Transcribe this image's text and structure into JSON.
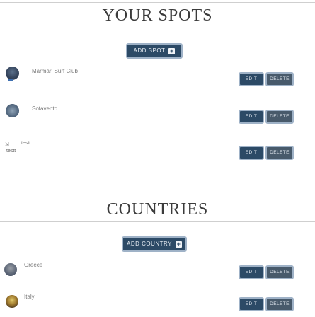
{
  "spots": {
    "title": "YOUR SPOTS",
    "add_button": "ADD SPOT",
    "items": [
      {
        "label": "Marmari Surf Club",
        "edit": "EDIT",
        "delete": "DELETE"
      },
      {
        "label": "Sotavento",
        "edit": "EDIT",
        "delete": "DELETE"
      },
      {
        "label": "testt",
        "sub_label": "testt",
        "edit": "EDIT",
        "delete": "DELETE"
      }
    ]
  },
  "countries": {
    "title": "COUNTRIES",
    "add_button": "ADD COUNTRY",
    "items": [
      {
        "label": "Greece",
        "edit": "EDIT",
        "delete": "DELETE"
      },
      {
        "label": "Italy",
        "edit": "EDIT",
        "delete": "DELETE"
      }
    ]
  },
  "colors": {
    "button_bg": "#2c4a66",
    "button_border": "#9fb2c7",
    "title_text": "#3b3b3b"
  }
}
